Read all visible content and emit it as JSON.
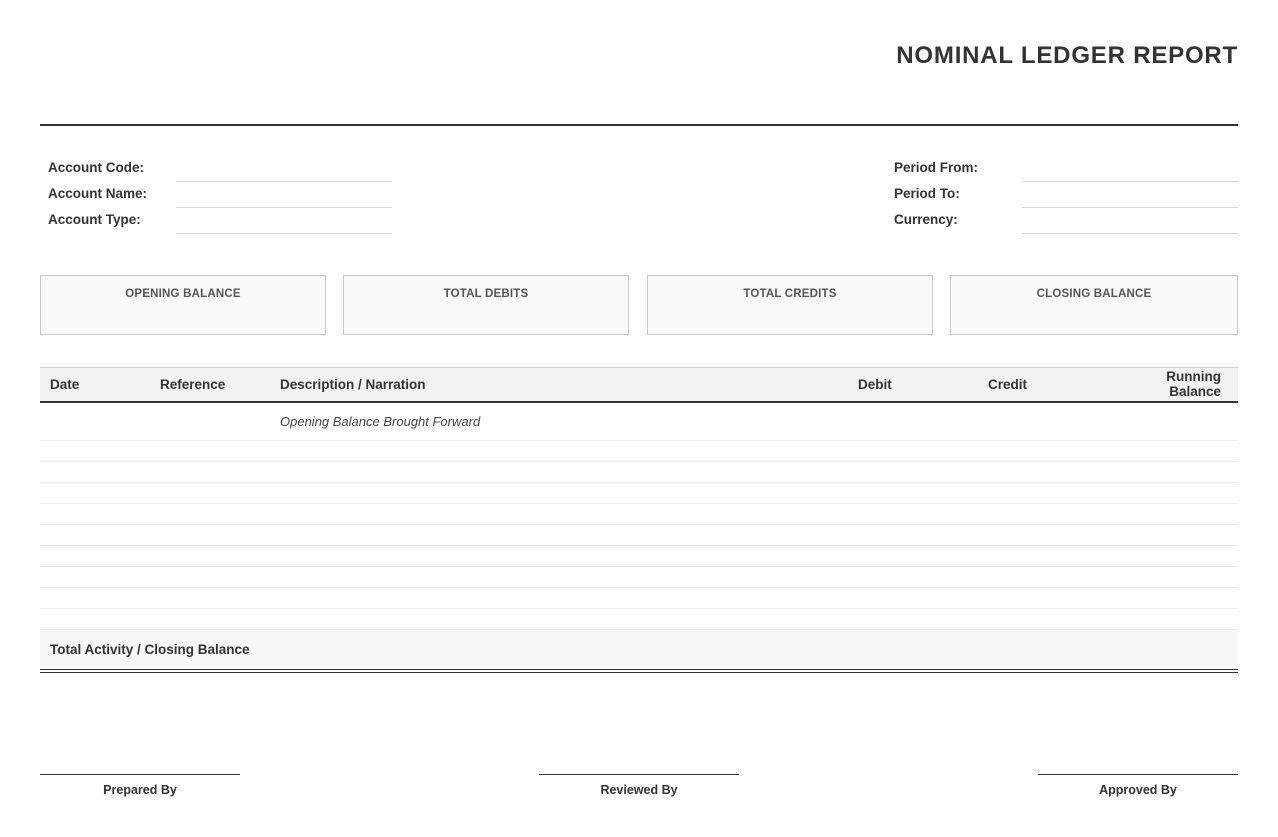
{
  "report": {
    "title": "NOMINAL LEDGER REPORT"
  },
  "account_info": {
    "code_label": "Account Code:",
    "name_label": "Account Name:",
    "type_label": "Account Type:"
  },
  "period_info": {
    "from_label": "Period From:",
    "to_label": "Period To:",
    "currency_label": "Currency:"
  },
  "summary": [
    {
      "label": "OPENING BALANCE"
    },
    {
      "label": "TOTAL DEBITS"
    },
    {
      "label": "TOTAL CREDITS"
    },
    {
      "label": "CLOSING BALANCE"
    }
  ],
  "ledger": {
    "columns": [
      "Date",
      "Reference",
      "Description / Narration",
      "Debit",
      "Credit",
      "Running Balance"
    ],
    "opening_row_description": "Opening Balance Brought Forward",
    "blank_row_count": 9,
    "total_label": "Total Activity / Closing Balance"
  },
  "signatures": [
    "Prepared By",
    "Reviewed By",
    "Approved By"
  ]
}
